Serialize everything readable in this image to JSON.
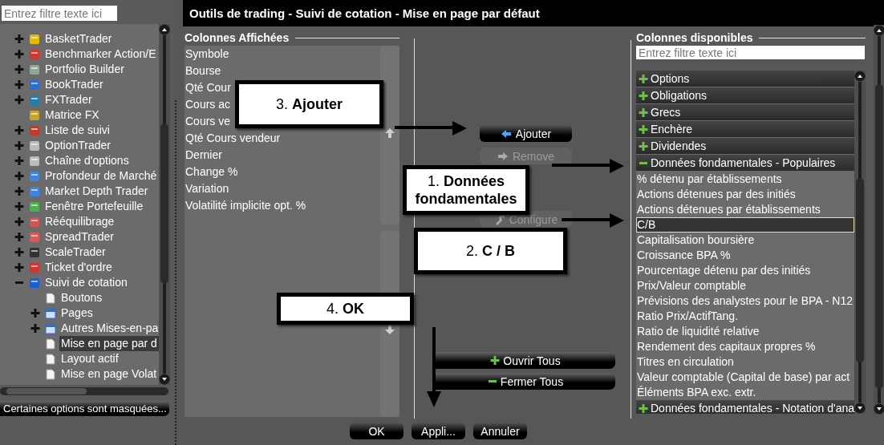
{
  "sidebar": {
    "filter": {
      "placeholder": "Entrez filtre texte ici"
    },
    "tree": [
      {
        "label": "BasketTrader",
        "expanded": false,
        "selected": false
      },
      {
        "label": "Benchmarker Action/E",
        "expanded": false,
        "selected": false
      },
      {
        "label": "Portfolio Builder",
        "expanded": false,
        "selected": false
      },
      {
        "label": "BookTrader",
        "expanded": false,
        "selected": false
      },
      {
        "label": "FXTrader",
        "expanded": false,
        "selected": false
      },
      {
        "label": "Matrice FX",
        "selected": false
      },
      {
        "label": "Liste de suivi",
        "expanded": false,
        "selected": false
      },
      {
        "label": "OptionTrader",
        "expanded": false,
        "selected": false
      },
      {
        "label": "Chaîne d'options",
        "expanded": false,
        "selected": false
      },
      {
        "label": "Profondeur de Marché",
        "expanded": false,
        "selected": false
      },
      {
        "label": "Market Depth Trader",
        "expanded": false,
        "selected": false
      },
      {
        "label": "Fenêtre Portefeuille",
        "expanded": false,
        "selected": false
      },
      {
        "label": "Rééquilibrage",
        "expanded": false,
        "selected": false
      },
      {
        "label": "SpreadTrader",
        "expanded": false,
        "selected": false
      },
      {
        "label": "ScaleTrader",
        "expanded": false,
        "selected": false
      },
      {
        "label": "Ticket d'ordre",
        "expanded": false,
        "selected": false
      },
      {
        "label": "Suivi de cotation",
        "expanded": true,
        "selected": false,
        "children": [
          {
            "label": "Boutons",
            "selected": false
          },
          {
            "label": "Pages",
            "expanded": false,
            "selected": false
          },
          {
            "label": "Autres Mises-en-pa",
            "expanded": false,
            "selected": false
          },
          {
            "label": "Mise en page par d",
            "selected": true
          },
          {
            "label": "Layout actif",
            "selected": false
          },
          {
            "label": "Mise en page Volat",
            "selected": false
          }
        ]
      }
    ],
    "notice_button": "Certaines options sont masquées..."
  },
  "window": {
    "title": "Outils de trading - Suivi de cotation - Mise en page par défaut"
  },
  "displayed_columns": {
    "title": "Colonnes Affichées",
    "items": [
      "Symbole",
      "Bourse",
      "Qté Cour",
      "Cours ac",
      "Cours ve",
      "Qté Cours vendeur",
      "Dernier",
      "Change %",
      "Variation",
      "Volatilité implicite opt. %"
    ]
  },
  "actions": [
    {
      "kind": "add",
      "label": "Ajouter",
      "disabled": false
    },
    {
      "kind": "remove",
      "label": "Remove",
      "disabled": true
    },
    {
      "kind": "configure",
      "label": "Configure",
      "disabled": true
    }
  ],
  "tree_buttons": [
    {
      "kind": "expand",
      "label": "Ouvrir Tous"
    },
    {
      "kind": "collapse",
      "label": "Fermer Tous"
    }
  ],
  "available_columns": {
    "title": "Colonnes disponibles",
    "filter": {
      "placeholder": "Entrez filtre texte ici"
    },
    "groups": [
      {
        "label": "Options",
        "expanded": false
      },
      {
        "label": "Obligations",
        "expanded": false
      },
      {
        "label": "Grecs",
        "expanded": false
      },
      {
        "label": "Enchère",
        "expanded": false
      },
      {
        "label": "Dividendes",
        "expanded": false
      },
      {
        "label": "Données fondamentales - Populaires",
        "expanded": true,
        "items": [
          {
            "label": "% détenu par établissements",
            "selected": false
          },
          {
            "label": "Actions détenues par des initiés",
            "selected": false
          },
          {
            "label": "Actions détenues par établissements",
            "selected": false
          },
          {
            "label": "C/B",
            "selected": true
          },
          {
            "label": "Capitalisation boursière",
            "selected": false
          },
          {
            "label": "Croissance BPA %",
            "selected": false
          },
          {
            "label": "Pourcentage détenu par des initiés",
            "selected": false
          },
          {
            "label": "Prix/Valeur comptable",
            "selected": false
          },
          {
            "label": "Prévisions des analystes pour le BPA - N12",
            "selected": false
          },
          {
            "label": "Ratio Prix/ActifTang.",
            "selected": false
          },
          {
            "label": "Ratio de liquidité relative",
            "selected": false
          },
          {
            "label": "Rendement des capitaux propres %",
            "selected": false
          },
          {
            "label": "Titres en circulation",
            "selected": false
          },
          {
            "label": "Valeur comptable (Capital de base) par act",
            "selected": false
          },
          {
            "label": "Éléments BPA exc. extr.",
            "selected": false
          }
        ]
      },
      {
        "label": "Données fondamentales - Notation d'ana",
        "expanded": false
      }
    ]
  },
  "dialog_buttons": [
    "OK",
    "Appli...",
    "Annuler"
  ],
  "annotations": [
    "3. **Ajouter**",
    "1. **Données fondamentales**",
    "2. **C / B**",
    "4. **OK**"
  ]
}
